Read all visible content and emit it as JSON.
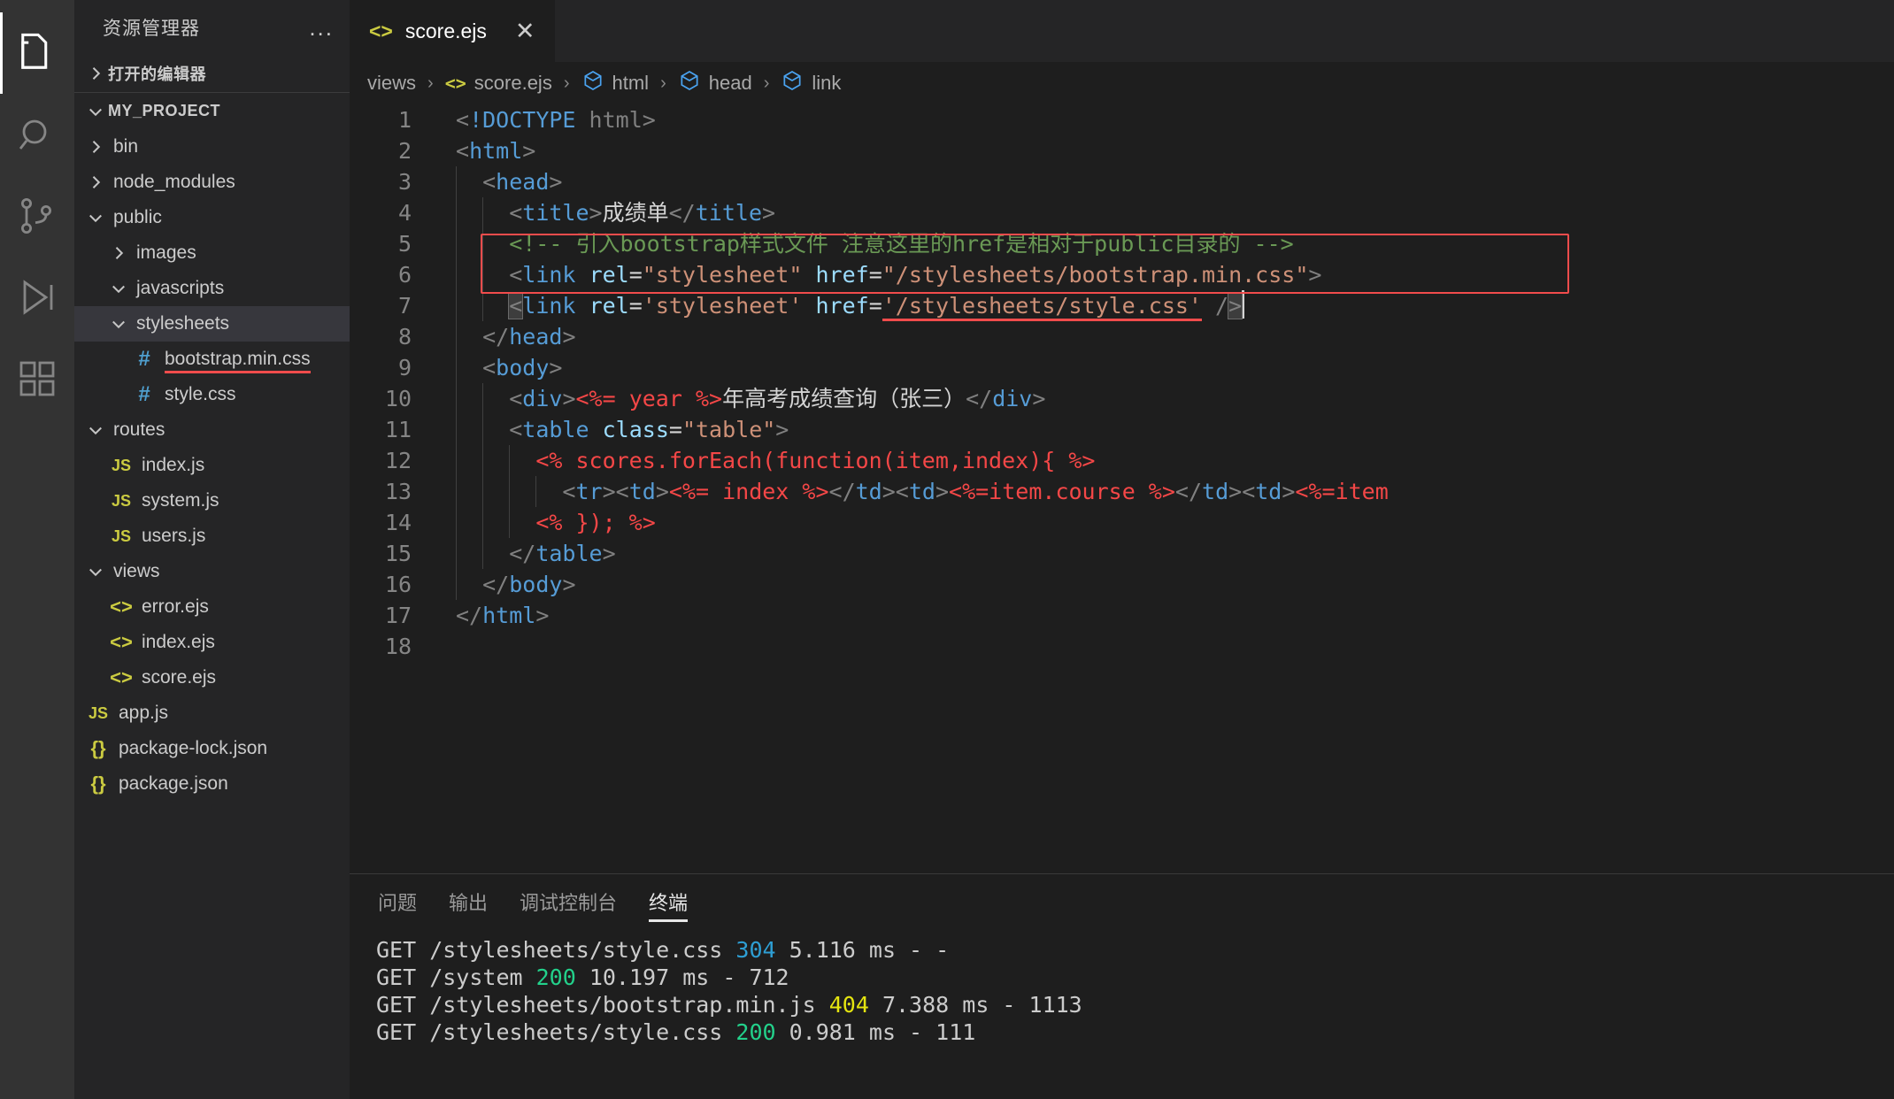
{
  "activity_bar": {
    "items": [
      {
        "name": "explorer",
        "icon": "files-icon",
        "active": true
      },
      {
        "name": "search",
        "icon": "search-icon",
        "active": false
      },
      {
        "name": "source-control",
        "icon": "source-control-icon",
        "active": false
      },
      {
        "name": "run-and-debug",
        "icon": "run-debug-icon",
        "active": false
      },
      {
        "name": "extensions",
        "icon": "extensions-icon",
        "active": false
      }
    ]
  },
  "sidebar": {
    "title": "资源管理器",
    "more_actions": "...",
    "open_editors_label": "打开的编辑器",
    "project_label": "MY_PROJECT",
    "tree": [
      {
        "label": "bin",
        "icon": "folder",
        "depth": 1,
        "state": "collapsed"
      },
      {
        "label": "node_modules",
        "icon": "folder",
        "depth": 1,
        "state": "collapsed"
      },
      {
        "label": "public",
        "icon": "folder",
        "depth": 1,
        "state": "expanded"
      },
      {
        "label": "images",
        "icon": "folder",
        "depth": 2,
        "state": "collapsed"
      },
      {
        "label": "javascripts",
        "icon": "folder",
        "depth": 2,
        "state": "expanded"
      },
      {
        "label": "stylesheets",
        "icon": "folder",
        "depth": 2,
        "state": "expanded",
        "selected": true
      },
      {
        "label": "bootstrap.min.css",
        "icon": "hash",
        "depth": 3,
        "error": true
      },
      {
        "label": "style.css",
        "icon": "hash",
        "depth": 3
      },
      {
        "label": "routes",
        "icon": "folder",
        "depth": 1,
        "state": "expanded"
      },
      {
        "label": "index.js",
        "icon": "js",
        "depth": 2
      },
      {
        "label": "system.js",
        "icon": "js",
        "depth": 2
      },
      {
        "label": "users.js",
        "icon": "js",
        "depth": 2
      },
      {
        "label": "views",
        "icon": "folder",
        "depth": 1,
        "state": "expanded"
      },
      {
        "label": "error.ejs",
        "icon": "ejs",
        "depth": 2
      },
      {
        "label": "index.ejs",
        "icon": "ejs",
        "depth": 2
      },
      {
        "label": "score.ejs",
        "icon": "ejs",
        "depth": 2
      },
      {
        "label": "app.js",
        "icon": "js",
        "depth": 1
      },
      {
        "label": "package-lock.json",
        "icon": "json",
        "depth": 1
      },
      {
        "label": "package.json",
        "icon": "json",
        "depth": 1
      }
    ]
  },
  "editor": {
    "tab": {
      "label": "score.ejs",
      "icon": "ejs-icon",
      "close": "✕"
    },
    "breadcrumbs": [
      {
        "label": "views",
        "icon": "none"
      },
      {
        "label": "score.ejs",
        "icon": "code"
      },
      {
        "label": "html",
        "icon": "cube"
      },
      {
        "label": "head",
        "icon": "cube"
      },
      {
        "label": "link",
        "icon": "cube"
      }
    ],
    "line_numbers": [
      "1",
      "2",
      "3",
      "4",
      "5",
      "6",
      "7",
      "8",
      "9",
      "10",
      "11",
      "12",
      "13",
      "14",
      "15",
      "16",
      "17",
      "18"
    ],
    "lines": [
      "<!DOCTYPE html>",
      "<html>",
      "  <head>",
      "    <title>成绩单</title>",
      "    <!-- 引入bootstrap样式文件 注意这里的href是相对于public目录的 -->",
      "    <link rel=\"stylesheet\" href=\"/stylesheets/bootstrap.min.css\">",
      "    <link rel='stylesheet' href='/stylesheets/style.css' />",
      "  </head>",
      "  <body>",
      "    <div><%= year %>年高考成绩查询（张三）</div>",
      "    <table class=\"table\">",
      "      <% scores.forEach(function(item,index){ %>",
      "        <tr><td><%= index %></td><td><%=item.course %></td><td><%=item",
      "      <% }); %>",
      "    </table>",
      "  </body>",
      "</html>",
      ""
    ],
    "highlight_color": "#f14c4c"
  },
  "panel": {
    "tabs": [
      {
        "label": "问题",
        "active": false
      },
      {
        "label": "输出",
        "active": false
      },
      {
        "label": "调试控制台",
        "active": false
      },
      {
        "label": "终端",
        "active": true
      }
    ],
    "terminal_lines": [
      {
        "method": "GET",
        "path": "/stylesheets/style.css",
        "status": "304",
        "status_kind": "s-304",
        "rest": "5.116 ms - -"
      },
      {
        "method": "GET",
        "path": "/system",
        "status": "200",
        "status_kind": "s-200",
        "rest": "10.197 ms - 712"
      },
      {
        "method": "GET",
        "path": "/stylesheets/bootstrap.min.js",
        "status": "404",
        "status_kind": "s-404",
        "rest": "7.388 ms - 1113"
      },
      {
        "method": "GET",
        "path": "/stylesheets/style.css",
        "status": "200",
        "status_kind": "s-200",
        "rest": "0.981 ms - 111"
      }
    ]
  }
}
